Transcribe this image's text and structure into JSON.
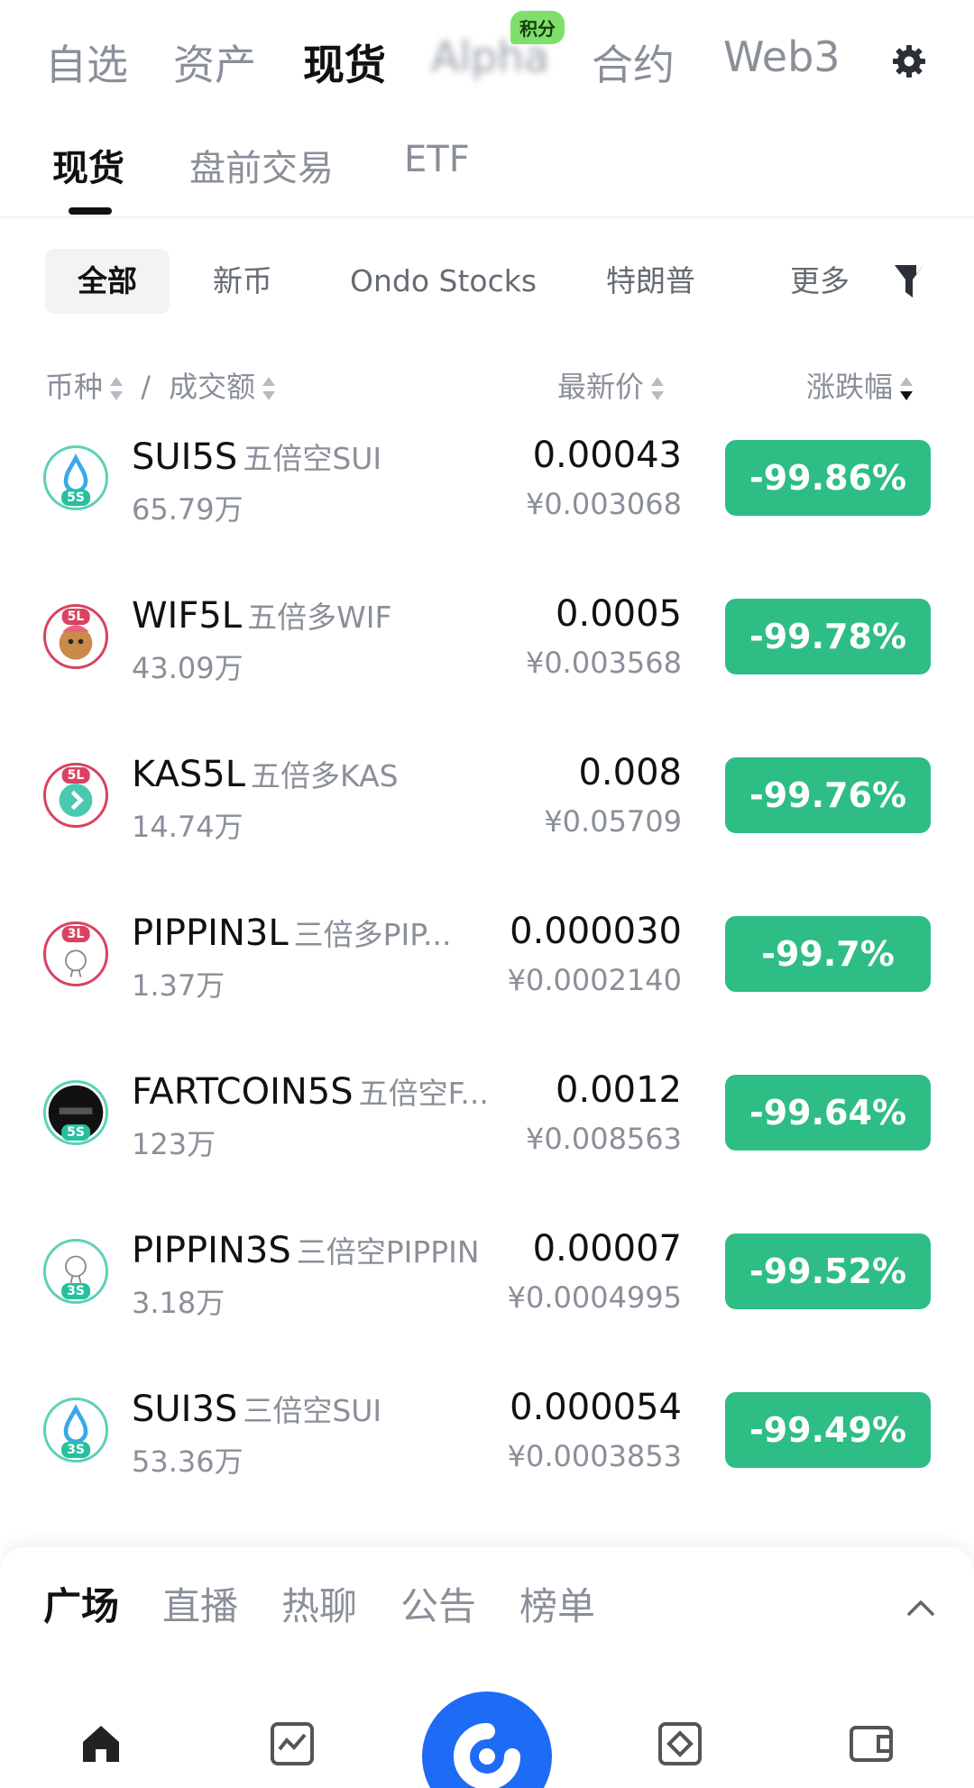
{
  "top_tabs": [
    "自选",
    "资产",
    "现货",
    "Alpha",
    "合约",
    "Web3"
  ],
  "top_badge": "积分",
  "sub_tabs": [
    "现货",
    "盘前交易",
    "ETF"
  ],
  "chips": [
    "全部",
    "新币",
    "Ondo Stocks",
    "特朗普",
    "更多"
  ],
  "columns": {
    "coin": "币种",
    "sep": "/",
    "volume": "成交额",
    "price": "最新价",
    "change": "涨跌幅"
  },
  "rows": [
    {
      "symbol": "SUI5S",
      "desc": "五倍空SUI",
      "volume": "65.79万",
      "price": "0.00043",
      "cny": "¥0.003068",
      "change": "-99.86%",
      "lev": "5S"
    },
    {
      "symbol": "WIF5L",
      "desc": "五倍多WIF",
      "volume": "43.09万",
      "price": "0.0005",
      "cny": "¥0.003568",
      "change": "-99.78%",
      "lev": "5L"
    },
    {
      "symbol": "KAS5L",
      "desc": "五倍多KAS",
      "volume": "14.74万",
      "price": "0.008",
      "cny": "¥0.05709",
      "change": "-99.76%",
      "lev": "5L"
    },
    {
      "symbol": "PIPPIN3L",
      "desc": "三倍多PIP...",
      "volume": "1.37万",
      "price": "0.000030",
      "cny": "¥0.0002140",
      "change": "-99.7%",
      "lev": "3L"
    },
    {
      "symbol": "FARTCOIN5S",
      "desc": "五倍空F...",
      "volume": "123万",
      "price": "0.0012",
      "cny": "¥0.008563",
      "change": "-99.64%",
      "lev": "5S"
    },
    {
      "symbol": "PIPPIN3S",
      "desc": "三倍空PIPPIN",
      "volume": "3.18万",
      "price": "0.00007",
      "cny": "¥0.0004995",
      "change": "-99.52%",
      "lev": "3S"
    },
    {
      "symbol": "SUI3S",
      "desc": "三倍空SUI",
      "volume": "53.36万",
      "price": "0.000054",
      "cny": "¥0.0003853",
      "change": "-99.49%",
      "lev": "3S"
    }
  ],
  "bottom_tabs": [
    "广场",
    "直播",
    "热聊",
    "公告",
    "榜单"
  ],
  "colors": {
    "up_red": "#d94361",
    "down_green": "#2ebd85",
    "brand_blue": "#1e6bf5"
  },
  "icons": {
    "settings": "gear-icon",
    "filter": "filter-icon",
    "collapse": "chevron-up-icon",
    "nav": [
      "home-icon",
      "markets-icon",
      "trade-center-icon",
      "discover-icon",
      "wallet-icon"
    ]
  }
}
